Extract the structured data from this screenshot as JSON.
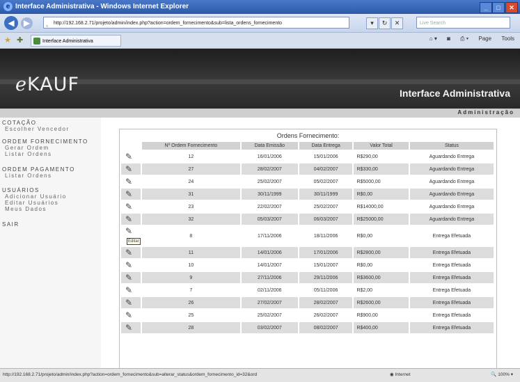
{
  "window": {
    "title": "Interface Administrativa - Windows Internet Explorer",
    "address": "http://192.168.2.71/projeto/admin/index.php?action=ordem_fornecimento&sub=lista_ordens_fornecimento",
    "search_placeholder": "Live Search",
    "tab_label": "Interface Administrativa",
    "tools": [
      "Page",
      "Tools"
    ]
  },
  "banner": {
    "logo_prefix": "e",
    "logo_rest": "KAUF",
    "subtitle": "Interface Administrativa",
    "section": "Administração"
  },
  "menu": [
    {
      "title": "COTAÇÃO",
      "items": [
        "Escolher Vencedor"
      ]
    },
    {
      "title": "ORDEM FORNECIMENTO",
      "items": [
        "Gerar Ordem",
        "Listar Ordens"
      ]
    },
    {
      "title": "ORDEM PAGAMENTO",
      "items": [
        "Listar Ordens"
      ]
    },
    {
      "title": "USUÁRIOS",
      "items": [
        "Adicionar Usuário",
        "Editar Usuários",
        "Meus Dados"
      ]
    },
    {
      "title": "SAIR",
      "items": []
    }
  ],
  "table": {
    "title": "Ordens Fornecimento:",
    "columns": [
      "Nº Ordem Fornecimento",
      "Data Emissão",
      "Data Entrega",
      "Valor Total",
      "Status"
    ],
    "edit_tooltip": "Editar",
    "rows": [
      [
        "12",
        "16/01/2006",
        "15/01/2006",
        "R$290,00",
        "Aguardando Entrega"
      ],
      [
        "27",
        "28/02/2007",
        "04/02/2007",
        "R$330,00",
        "Aguardando Entrega"
      ],
      [
        "24",
        "25/02/2007",
        "05/02/2007",
        "R$5000,00",
        "Aguardando Entrega"
      ],
      [
        "31",
        "30/11/1999",
        "30/11/1999",
        "R$0,00",
        "Aguardando Entrega"
      ],
      [
        "23",
        "22/02/2007",
        "25/02/2007",
        "R$14000,00",
        "Aguardando Entrega"
      ],
      [
        "32",
        "05/03/2007",
        "06/03/2007",
        "R$25000,00",
        "Aguardando Entrega"
      ],
      [
        "8",
        "17/11/2006",
        "18/11/2006",
        "R$0,00",
        "Entrega Efetuada"
      ],
      [
        "11",
        "14/01/2006",
        "17/01/2006",
        "R$2800,00",
        "Entrega Efetuada"
      ],
      [
        "10",
        "14/01/2007",
        "15/01/2007",
        "R$0,00",
        "Entrega Efetuada"
      ],
      [
        "9",
        "27/11/2006",
        "29/11/2006",
        "R$3600,00",
        "Entrega Efetuada"
      ],
      [
        "7",
        "02/11/2006",
        "05/11/2006",
        "R$2,00",
        "Entrega Efetuada"
      ],
      [
        "26",
        "27/02/2007",
        "28/02/2007",
        "R$2600,00",
        "Entrega Efetuada"
      ],
      [
        "25",
        "25/02/2007",
        "26/02/2007",
        "R$900,00",
        "Entrega Efetuada"
      ],
      [
        "28",
        "03/02/2007",
        "08/02/2007",
        "R$400,00",
        "Entrega Efetuada"
      ]
    ]
  },
  "status": {
    "url": "http://192.168.2.71/projeto/admin/index.php?action=ordem_fornecimento&sub=alterar_status&ordem_fornecimento_id=32&ord",
    "zone": "Internet",
    "zoom": "100%"
  }
}
